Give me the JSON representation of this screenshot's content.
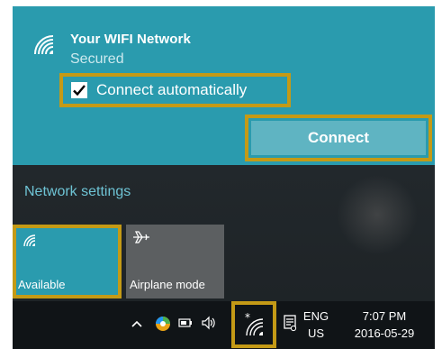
{
  "network": {
    "ssid": "Your WIFI Network",
    "security": "Secured",
    "auto_connect_label": "Connect automatically",
    "auto_connect_checked": true,
    "connect_label": "Connect"
  },
  "action_center": {
    "network_settings_link": "Network settings",
    "tiles": [
      {
        "label": "Available",
        "icon": "wifi-icon",
        "state": "on"
      },
      {
        "label": "Airplane mode",
        "icon": "airplane-icon",
        "state": "off"
      }
    ]
  },
  "taskbar": {
    "tray_icons": [
      "chevron-up-icon",
      "colorful-app-icon",
      "battery-icon",
      "volume-icon",
      "wifi-icon",
      "notifications-icon"
    ],
    "language_line1": "ENG",
    "language_line2": "US",
    "time": "7:07 PM",
    "date": "2016-05-29"
  },
  "colors": {
    "accent": "#2a9bae",
    "highlight": "#c49a16",
    "taskbar": "#101417"
  }
}
